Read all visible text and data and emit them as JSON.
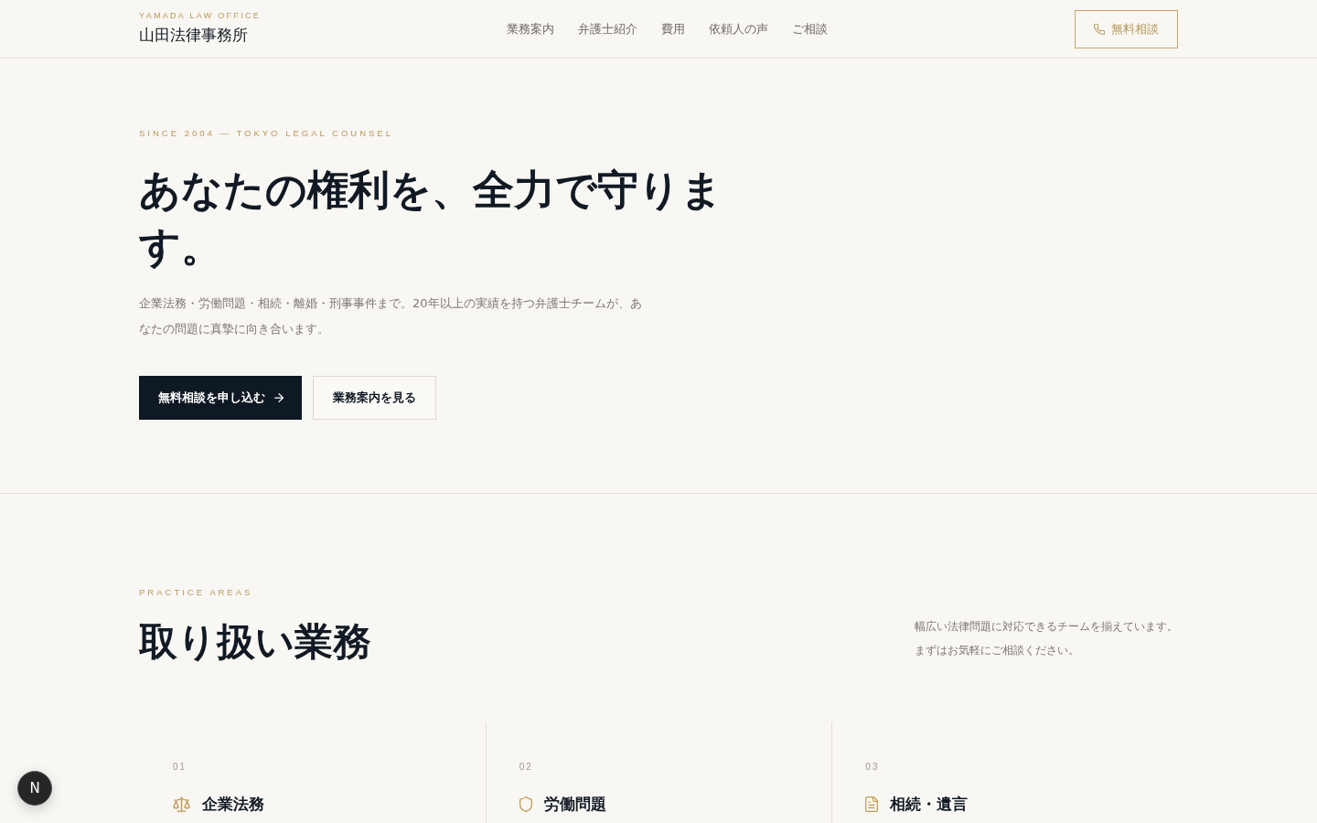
{
  "header": {
    "brand_tagline": "YAMADA LAW OFFICE",
    "brand_name": "山田法律事務所",
    "nav": [
      {
        "label": "業務案内"
      },
      {
        "label": "弁護士紹介"
      },
      {
        "label": "費用"
      },
      {
        "label": "依頼人の声"
      },
      {
        "label": "ご相談"
      }
    ],
    "cta": {
      "label": "無料相談"
    }
  },
  "hero": {
    "eyebrow": "SINCE 2004 — TOKYO LEGAL COUNSEL",
    "headline": "あなたの権利を、全力で守ります。",
    "description": "企業法務・労働問題・相続・離婚・刑事事件まで。20年以上の実績を持つ弁護士チームが、あなたの問題に真摯に向き合います。",
    "buttons": [
      {
        "label": "無料相談を申し込む",
        "kind": "primary"
      },
      {
        "label": "業務案内を見る",
        "kind": "secondary"
      }
    ]
  },
  "practice": {
    "eyebrow": "PRACTICE AREAS",
    "heading": "取り扱い業務",
    "intro": "幅広い法律問題に対応できるチームを揃えています。まずはお気軽にご相談ください。",
    "areas": [
      {
        "number": "01",
        "title": "企業法務",
        "kind": "scale"
      },
      {
        "number": "02",
        "title": "労働問題",
        "kind": "shield"
      },
      {
        "number": "03",
        "title": "相続・遺言",
        "kind": "document"
      }
    ]
  },
  "dev_badge": {
    "label": "N"
  }
}
